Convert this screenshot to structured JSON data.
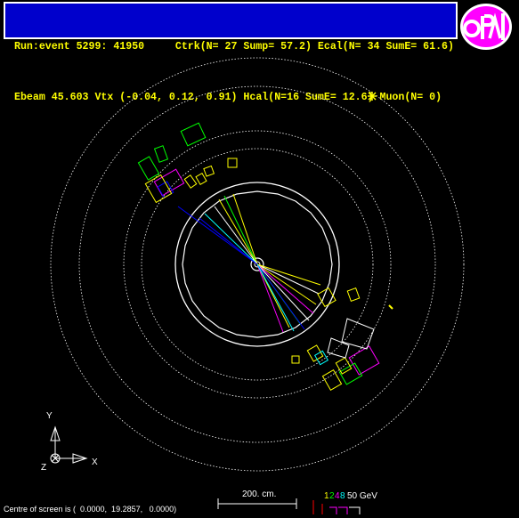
{
  "header": {
    "line1": "Run:event 5299: 41950     Ctrk(N= 27 Sump= 57.2) Ecal(N= 34 SumE= 61.6)",
    "line2": "Ebeam 45.603 Vtx (-0.04, 0.12, 0.91) Hcal(N=16 SumE= 12.6) Muon(N= 0)"
  },
  "logo": {
    "text": "OPAL"
  },
  "axes": {
    "y_label": "Y",
    "x_label": "X",
    "z_label": "Z"
  },
  "scale": {
    "label": "200. cm."
  },
  "energy_scale": {
    "label_1": "1",
    "label_2": "2",
    "label_4": "4",
    "label_8": "8",
    "label_16": "16",
    "label_50": "50 GeV"
  },
  "footer": {
    "centre_text": "Centre of screen is (  0.0000,  19.2857,   0.0000)"
  },
  "colors": {
    "header_bg": "#0000cc",
    "header_text": "#ffff00",
    "background": "#000000"
  }
}
